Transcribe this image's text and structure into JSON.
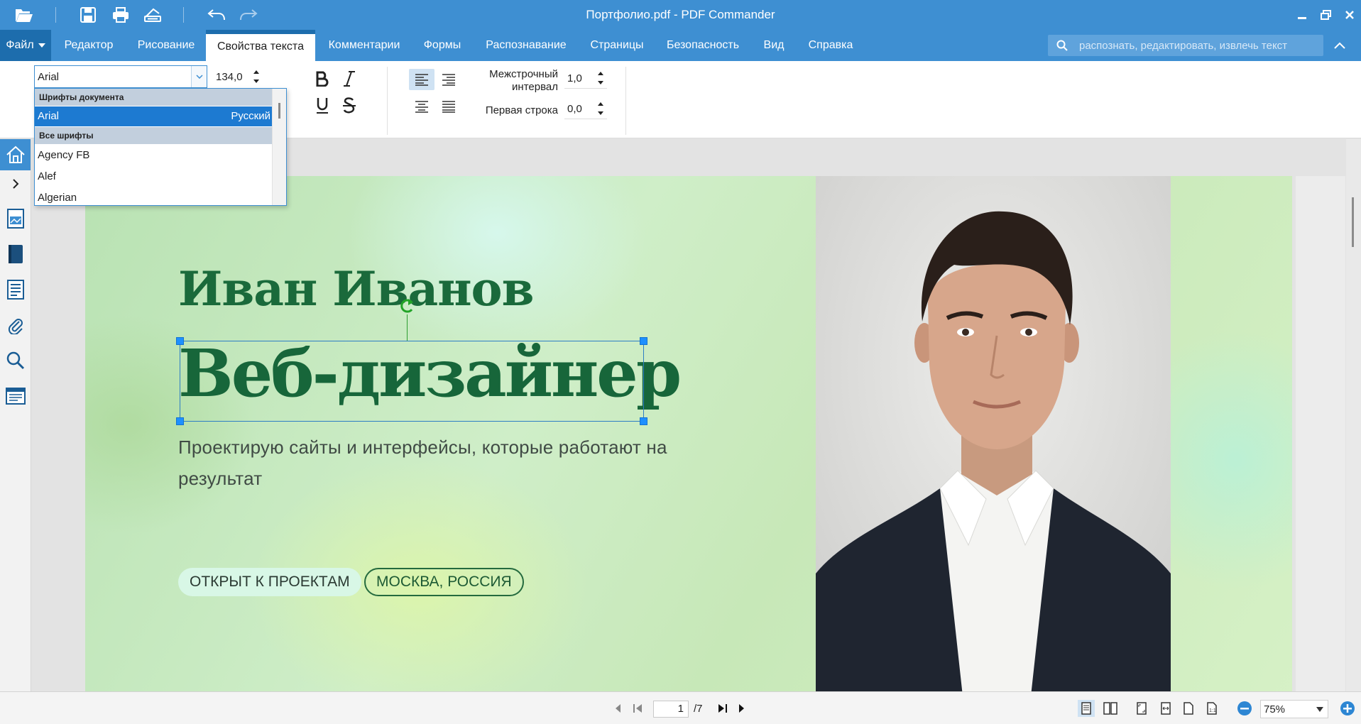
{
  "window": {
    "title": "Портфолио.pdf - PDF Commander"
  },
  "menu": {
    "file_label": "Файл",
    "tabs": [
      {
        "label": "Редактор"
      },
      {
        "label": "Рисование"
      },
      {
        "label": "Свойства текста"
      },
      {
        "label": "Комментарии"
      },
      {
        "label": "Формы"
      },
      {
        "label": "Распознавание"
      },
      {
        "label": "Страницы"
      },
      {
        "label": "Безопасность"
      },
      {
        "label": "Вид"
      },
      {
        "label": "Справка"
      }
    ],
    "active_tab": "Свойства текста",
    "search_placeholder": "распознать, редактировать, извлечь текст"
  },
  "ribbon": {
    "font": "Arial",
    "font_size": "134,0",
    "line_spacing_label": "Межстрочный интервал",
    "line_spacing_label_1": "Межстрочный",
    "line_spacing_label_2": "интервал",
    "line_spacing_value": "1,0",
    "first_line_label": "Первая строка",
    "first_line_value": "0,0"
  },
  "font_dropdown": {
    "group_document": "Шрифты документа",
    "document_fonts": [
      {
        "name": "Arial",
        "tag": "Русский"
      }
    ],
    "group_all": "Все шрифты",
    "all_fonts": [
      {
        "name": "Agency FB"
      },
      {
        "name": "Alef"
      },
      {
        "name": "Algerian"
      }
    ]
  },
  "document": {
    "name": "Иван Иванов",
    "job_title": "Веб-дизайнер",
    "subtitle": "Проектирую сайты и интерфейсы, которые работают на результат",
    "badge_open": "ОТКРЫТ К ПРОЕКТАМ",
    "badge_location": "МОСКВА, РОССИЯ"
  },
  "status": {
    "current_page": "1",
    "total_pages": "/7",
    "zoom": "75%"
  },
  "colors": {
    "accent": "#3e8fd2",
    "accent_dark": "#1d6dad",
    "heading_green": "#1a6a3b"
  }
}
